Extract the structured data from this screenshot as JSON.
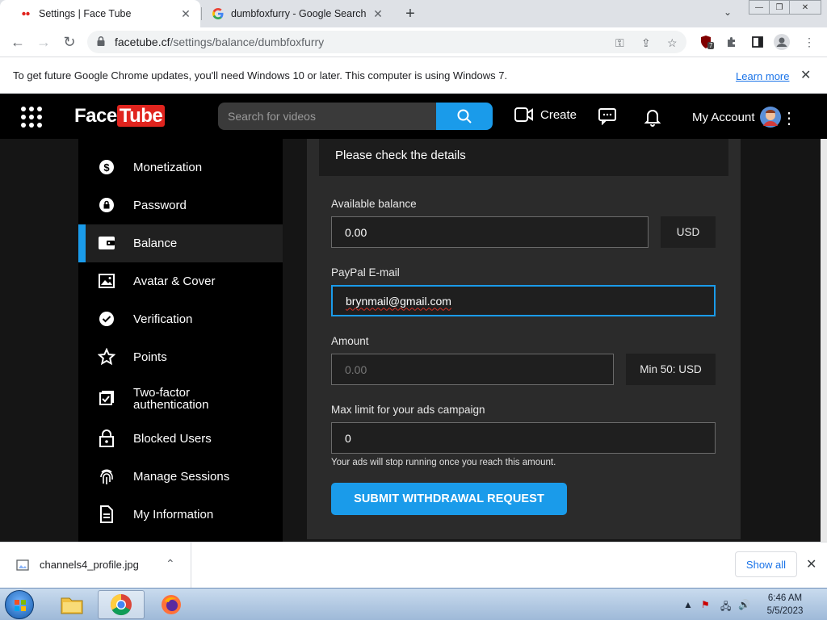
{
  "browser": {
    "tabs": [
      {
        "title": "Settings | Face Tube",
        "active": true
      },
      {
        "title": "dumbfoxfurry - Google Search",
        "active": false
      }
    ],
    "url_host": "facetube.cf",
    "url_path": "/settings/balance/dumbfoxfurry",
    "extension_badge": "7"
  },
  "infobar": {
    "message": "To get future Google Chrome updates, you'll need Windows 10 or later. This computer is using Windows 7.",
    "link": "Learn more"
  },
  "site": {
    "logo_face": "Face",
    "logo_tube": "Tube",
    "search_placeholder": "Search for videos",
    "create_label": "Create",
    "account_label": "My Account"
  },
  "sidebar": {
    "items": [
      {
        "label": "Monetization",
        "icon": "dollar-icon"
      },
      {
        "label": "Password",
        "icon": "lock-icon"
      },
      {
        "label": "Balance",
        "icon": "wallet-icon",
        "active": true
      },
      {
        "label": "Avatar & Cover",
        "icon": "image-icon"
      },
      {
        "label": "Verification",
        "icon": "check-circle-icon"
      },
      {
        "label": "Points",
        "icon": "star-icon"
      },
      {
        "label": "Two-factor authentication",
        "icon": "shield-check-icon"
      },
      {
        "label": "Blocked Users",
        "icon": "lock-icon"
      },
      {
        "label": "Manage Sessions",
        "icon": "fingerprint-icon"
      },
      {
        "label": "My Information",
        "icon": "document-icon"
      }
    ]
  },
  "form": {
    "heading": "Please check the details",
    "balance_label": "Available balance",
    "balance_value": "0.00",
    "balance_currency": "USD",
    "paypal_label": "PayPal E-mail",
    "paypal_value": "brynmail@gmail.com",
    "amount_label": "Amount",
    "amount_placeholder": "0.00",
    "amount_min": "Min 50: USD",
    "max_label": "Max limit for your ads campaign",
    "max_value": "0",
    "hint": "Your ads will stop running once you reach this amount.",
    "submit_label": "SUBMIT WITHDRAWAL REQUEST"
  },
  "downloads": {
    "filename": "channels4_profile.jpg",
    "show_all": "Show all"
  },
  "taskbar": {
    "time": "6:46 AM",
    "date": "5/5/2023"
  },
  "colors": {
    "accent": "#1a9bea",
    "logo_red": "#e0241e",
    "panel_bg": "#2b2b2b",
    "sidebar_bg": "#000000"
  }
}
